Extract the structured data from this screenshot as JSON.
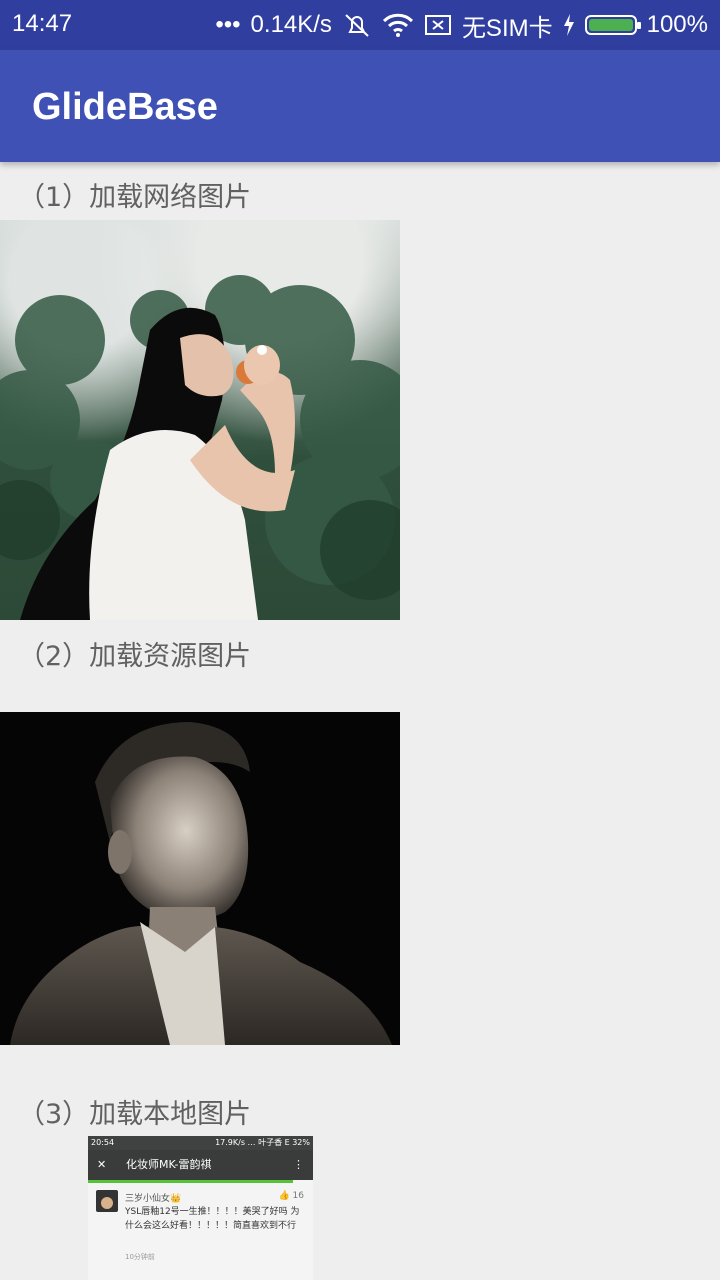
{
  "status_bar": {
    "time": "14:47",
    "dots": "•••",
    "speed": "0.14K/s",
    "carrier": "无SIM卡",
    "battery": "100%",
    "battery_color": "#4caf50",
    "icons": [
      "mute-vibrate-icon",
      "wifi-icon",
      "no-sim-icon",
      "charging-icon",
      "battery-icon"
    ]
  },
  "app_bar": {
    "title": "GlideBase",
    "color": "#3f51b5",
    "status_color": "#303f9f"
  },
  "sections": [
    {
      "label": "（1）加载网络图片"
    },
    {
      "label": "（2）加载资源图片"
    },
    {
      "label": "（3）加载本地图片"
    }
  ],
  "local_image": {
    "status_time": "20:54",
    "status_right": "17.9K/s … 叶子香 E 32%",
    "close_glyph": "✕",
    "title": "化妆师MK-雷韵祺",
    "more_glyph": "⋮",
    "user": "三岁小仙女👑",
    "likes": "👍 16",
    "comment": "YSL唇釉12号一生推！！！！美哭了好吗 为什么会这么好看！！！！！简直喜欢到不行",
    "time_ago": "10分钟前"
  }
}
